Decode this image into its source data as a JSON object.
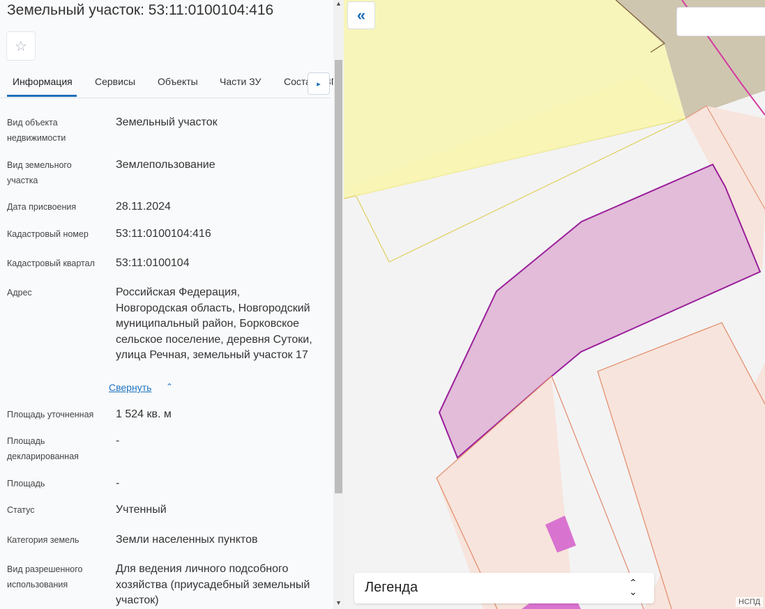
{
  "header": {
    "title": "Земельный участок: 53:11:0100104:416"
  },
  "favorite": {
    "icon": "star-icon",
    "glyph": "☆"
  },
  "tabs": [
    {
      "label": "Информация",
      "active": true
    },
    {
      "label": "Сервисы",
      "active": false
    },
    {
      "label": "Объекты",
      "active": false
    },
    {
      "label": "Части ЗУ",
      "active": false
    },
    {
      "label": "Состав ЕЗП",
      "active": false
    }
  ],
  "tabs_scroll_glyph": "▸",
  "info": [
    {
      "label": "Вид объекта недвижимости",
      "value": "Земельный участок"
    },
    {
      "label": "Вид земельного участка",
      "value": "Землепользование"
    },
    {
      "label": "Дата присвоения",
      "value": "28.11.2024"
    },
    {
      "label": "Кадастровый номер",
      "value": "53:11:0100104:416"
    },
    {
      "label": "Кадастровый квартал",
      "value": "53:11:0100104"
    },
    {
      "label": "Адрес",
      "value": "Российская Федерация, Новгородская область, Новгородский муниципальный район, Борковское сельское поселение, деревня Сутоки, улица Речная, земельный участок 17"
    },
    {
      "label": "Площадь уточненная",
      "value": "1 524 кв. м"
    },
    {
      "label": "Площадь декларированная",
      "value": "-"
    },
    {
      "label": "Площадь",
      "value": "-"
    },
    {
      "label": "Статус",
      "value": "Учтенный"
    },
    {
      "label": "Категория земель",
      "value": "Земли населенных пунктов"
    },
    {
      "label": "Вид разрешенного использования",
      "value": "Для ведения личного подсобного хозяйства (приусадебный земельный участок)"
    }
  ],
  "address_toggle": {
    "label": "Свернуть",
    "icon": "chevron-up-icon",
    "glyph": "⌃"
  },
  "scrollbar": {
    "up_glyph": "▲",
    "down_glyph": "▼"
  },
  "map": {
    "collapse_glyph": "«",
    "legend_label": "Легенда",
    "legend_toggle_glyph_up": "⌃",
    "legend_toggle_glyph_down": "⌄",
    "attribution": "НСПД",
    "colors": {
      "background": "#f3f3f4",
      "yellow_fill": "#f8f5b4",
      "yellow_stroke": "#e0cf5a",
      "road_fill": "#cfc6b0",
      "road_stroke": "#7a5a30",
      "peach_fill": "#f7e4dc",
      "peach_stroke": "#e38a68",
      "selected_fill": "#e0b6d6",
      "selected_stroke": "#9a1f9a",
      "building_fill": "#d873cf",
      "pink_line": "#d43ba0"
    }
  }
}
